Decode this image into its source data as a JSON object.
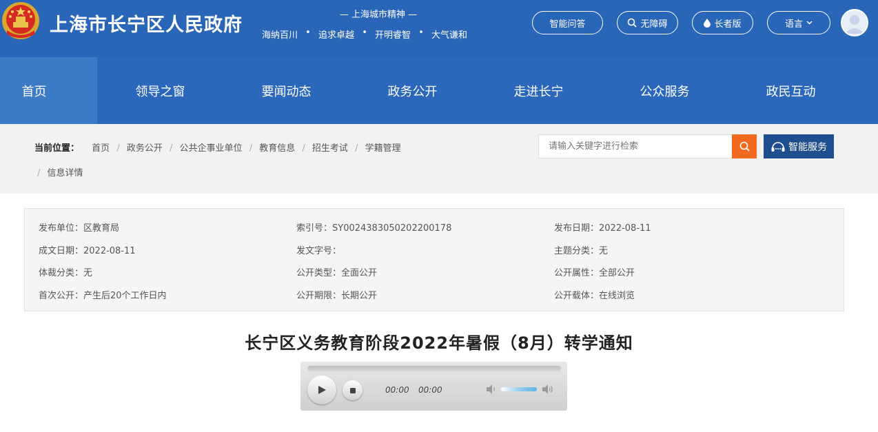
{
  "header": {
    "site_title": "上海市长宁区人民政府",
    "spirit_title": "— 上海城市精神 —",
    "spirit_words": [
      "海纳百川",
      "追求卓越",
      "开明睿智",
      "大气谦和"
    ],
    "spirit_dot": "•",
    "buttons": {
      "qa": "智能问答",
      "accessible": "无障碍",
      "elder": "长者版",
      "language": "语言"
    }
  },
  "nav": {
    "items": [
      "首页",
      "领导之窗",
      "要闻动态",
      "政务公开",
      "走进长宁",
      "公众服务",
      "政民互动"
    ]
  },
  "breadcrumb": {
    "label": "当前位置：",
    "separator": "/",
    "items": [
      "首页",
      "政务公开",
      "公共企事业单位",
      "教育信息",
      "招生考试",
      "学籍管理",
      "信息详情"
    ]
  },
  "search": {
    "placeholder": "请输入关键字进行检索",
    "smart_service": "智能服务"
  },
  "info": {
    "rows": [
      [
        "发布单位：区教育局",
        "索引号：SY0024383050202200178",
        "发布日期：2022-08-11"
      ],
      [
        "成文日期：2022-08-11",
        "发文字号：",
        "主题分类：无"
      ],
      [
        "体裁分类：无",
        "公开类型：全面公开",
        "公开属性：全部公开"
      ],
      [
        "首次公开：产生后20个工作日内",
        "公开期限：长期公开",
        "公开载体：在线浏览"
      ]
    ]
  },
  "article": {
    "title": "长宁区义务教育阶段2022年暑假（8月）转学通知"
  },
  "player": {
    "current_time": "00:00",
    "duration": "00:00",
    "volume": 1.0
  },
  "colors": {
    "header_bg": "#2a66b8",
    "nav_bg": "#2b68bb",
    "nav_active": "#3b7bc6",
    "search_button": "#f26a21",
    "smart_button": "#1f4e8f"
  },
  "icons": [
    "national-emblem-icon",
    "search-icon",
    "water-drop-icon",
    "chevron-down-icon",
    "avatar-icon",
    "headset-icon",
    "play-icon",
    "stop-icon",
    "volume-low-icon",
    "volume-high-icon"
  ]
}
